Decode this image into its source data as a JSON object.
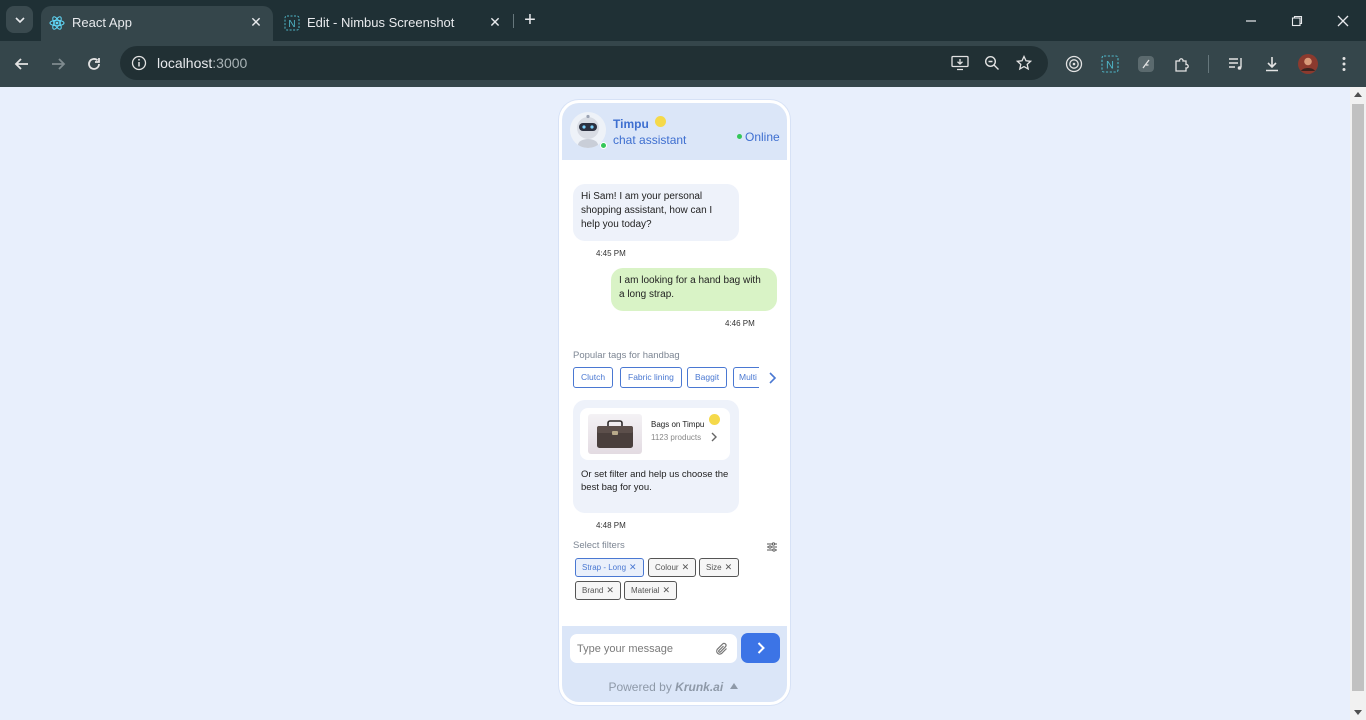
{
  "browser": {
    "tabs": [
      {
        "title": "React App",
        "active": true
      },
      {
        "title": "Edit - Nimbus Screenshot",
        "active": false
      }
    ],
    "url_host": "localhost",
    "url_port": ":3000"
  },
  "header": {
    "bot_name": "Timpu",
    "bot_role": "chat assistant",
    "status": "Online"
  },
  "messages": [
    {
      "from": "bot",
      "text": "Hi Sam! I am your personal shopping assistant, how can I help you today?",
      "time": "4:45 PM"
    },
    {
      "from": "user",
      "text": "I am looking for a hand bag with a long strap.",
      "time": "4:46 PM"
    }
  ],
  "tags": {
    "label": "Popular tags for handbag",
    "items": [
      "Clutch",
      "Fabric lining",
      "Baggit",
      "Multi"
    ]
  },
  "product": {
    "name": "Bags on Timpu",
    "count": "1123 products",
    "note": "Or set filter and help us choose the best bag for you.",
    "time": "4:48 PM"
  },
  "filters": {
    "label": "Select filters",
    "chips": [
      "Strap - Long",
      "Colour",
      "Size",
      "Brand",
      "Material"
    ]
  },
  "composer": {
    "placeholder": "Type your message"
  },
  "footer": {
    "powered_by": "Powered by",
    "brand": "Krunk.ai"
  },
  "colors": {
    "accent": "#3c74e6",
    "header_bg": "#dbe6f8",
    "user_bubble": "#d9f3c6",
    "bot_bubble": "#eef2fa",
    "online": "#34c759"
  }
}
